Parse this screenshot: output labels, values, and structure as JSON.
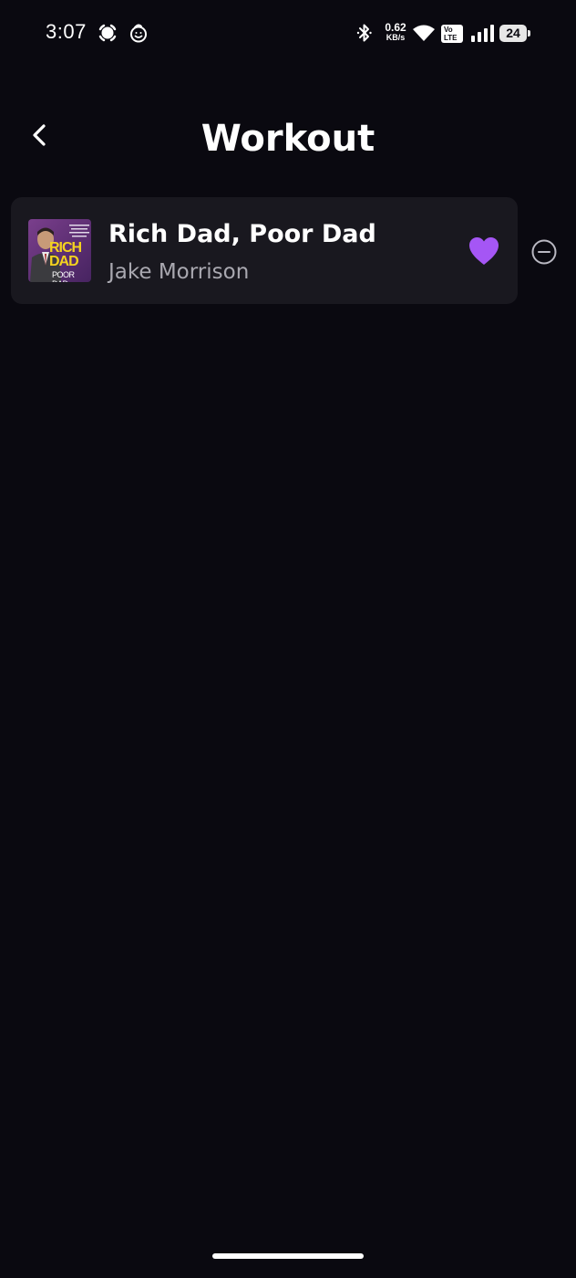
{
  "status_bar": {
    "time": "3:07",
    "net_speed_value": "0.62",
    "net_speed_unit": "KB/s",
    "volte_label": "Vo\nLTE",
    "battery_level": "24",
    "icons": [
      "screen-record-icon",
      "baby-face-icon",
      "bluetooth-icon",
      "wifi-icon",
      "signal-icon",
      "battery-icon"
    ]
  },
  "header": {
    "title": "Workout",
    "back_icon": "chevron-left-icon"
  },
  "tracks": [
    {
      "title": "Rich Dad, Poor Dad",
      "artist": "Jake Morrison",
      "cover_text_top": "RICH\nDAD",
      "cover_text_bottom": "POOR DAD",
      "favorited": true,
      "heart_icon": "heart-icon",
      "remove_icon": "minus-circle-icon"
    }
  ],
  "colors": {
    "background": "#0a0910",
    "card": "#19181f",
    "accent": "#a556f5",
    "muted_text": "#a9a8b0"
  }
}
